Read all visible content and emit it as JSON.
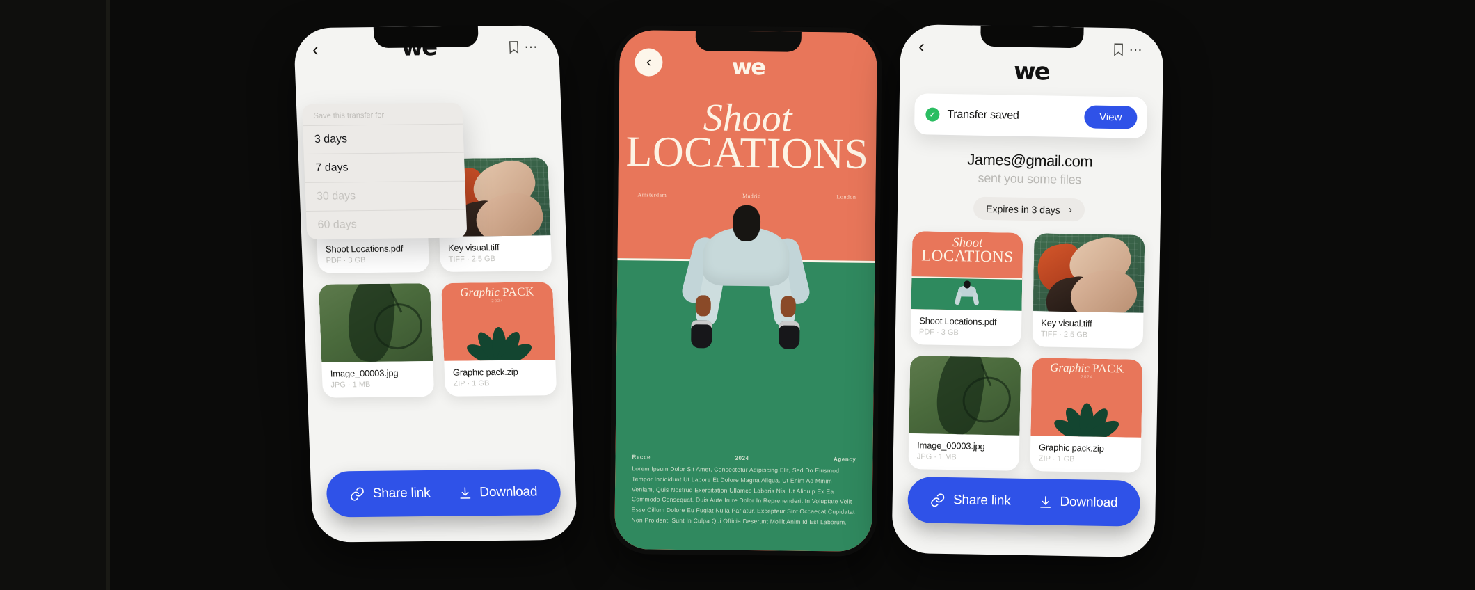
{
  "background": {
    "color": "#0b0b0a",
    "strip_color": "#0f0f0d"
  },
  "brand": {
    "logo": "we",
    "accent_blue": "#2f52e8",
    "accent_orange": "#e8765a",
    "accent_green": "#30895f",
    "success_green": "#2bbd62"
  },
  "phone1": {
    "header": {
      "back_icon": "chevron-left-icon",
      "logo": "we",
      "bookmark_icon": "bookmark-icon",
      "more_icon": "more-horizontal-icon"
    },
    "dropdown": {
      "title": "Save this transfer for",
      "options": [
        {
          "label": "3 days",
          "dim": false
        },
        {
          "label": "7 days",
          "dim": false
        },
        {
          "label": "30 days",
          "dim": true
        },
        {
          "label": "60 days",
          "dim": true
        }
      ]
    },
    "files": [
      {
        "name": "Shoot Locations.pdf",
        "meta": "PDF · 3 GB",
        "thumb": "poster"
      },
      {
        "name": "Key visual.tiff",
        "meta": "TIFF · 2.5 GB",
        "thumb": "keyvisual"
      },
      {
        "name": "Image_00003.jpg",
        "meta": "JPG · 1 MB",
        "thumb": "image"
      },
      {
        "name": "Graphic pack.zip",
        "meta": "ZIP · 1 GB",
        "thumb": "graphicpack"
      }
    ],
    "actions": {
      "share_label": "Share link",
      "share_icon": "link-icon",
      "download_label": "Download",
      "download_icon": "download-icon"
    }
  },
  "phone2": {
    "back_icon": "chevron-left-circle-icon",
    "logo": "we",
    "title_line1": "Shoot",
    "title_line2": "LOCATIONS",
    "cities": [
      "Amsterdam",
      "Madrid",
      "London"
    ],
    "footer_left": "Recce",
    "footer_mid": "2024",
    "footer_right": "Agency",
    "footer_body": "Lorem Ipsum Dolor Sit Amet, Consectetur Adipiscing Elit, Sed Do Eiusmod Tempor Incididunt Ut Labore Et Dolore Magna Aliqua. Ut Enim Ad Minim Veniam, Quis Nostrud Exercitation Ullamco Laboris Nisi Ut Aliquip Ex Ea Commodo Consequat. Duis Aute Irure Dolor In Reprehenderit In Voluptate Velit Esse Cillum Dolore Eu Fugiat Nulla Pariatur. Excepteur Sint Occaecat Cupidatat Non Proident, Sunt In Culpa Qui Officia Deserunt Mollit Anim Id Est Laborum."
  },
  "phone3": {
    "header": {
      "back_icon": "chevron-left-icon",
      "logo": "we",
      "bookmark_icon": "bookmark-icon",
      "more_icon": "more-horizontal-icon"
    },
    "toast": {
      "status_icon": "check-circle-icon",
      "message": "Transfer saved",
      "button_label": "View"
    },
    "sender": {
      "email": "James@gmail.com",
      "subtitle": "sent you some files"
    },
    "expires": {
      "label": "Expires in 3 days",
      "chevron": "chevron-right-icon"
    },
    "files": [
      {
        "name": "Shoot Locations.pdf",
        "meta": "PDF · 3 GB",
        "thumb": "poster"
      },
      {
        "name": "Key visual.tiff",
        "meta": "TIFF · 2.5 GB",
        "thumb": "keyvisual"
      },
      {
        "name": "Image_00003.jpg",
        "meta": "JPG · 1 MB",
        "thumb": "image"
      },
      {
        "name": "Graphic pack.zip",
        "meta": "ZIP · 1 GB",
        "thumb": "graphicpack"
      }
    ],
    "actions": {
      "share_label": "Share link",
      "share_icon": "link-icon",
      "download_label": "Download",
      "download_icon": "download-icon"
    }
  },
  "thumb_art": {
    "poster_title_line1": "Shoot",
    "poster_title_line2": "LOCATIONS",
    "graphic_pack_title_italic": "Graphic ",
    "graphic_pack_title_caps": "PACK",
    "graphic_pack_year": "2024"
  }
}
